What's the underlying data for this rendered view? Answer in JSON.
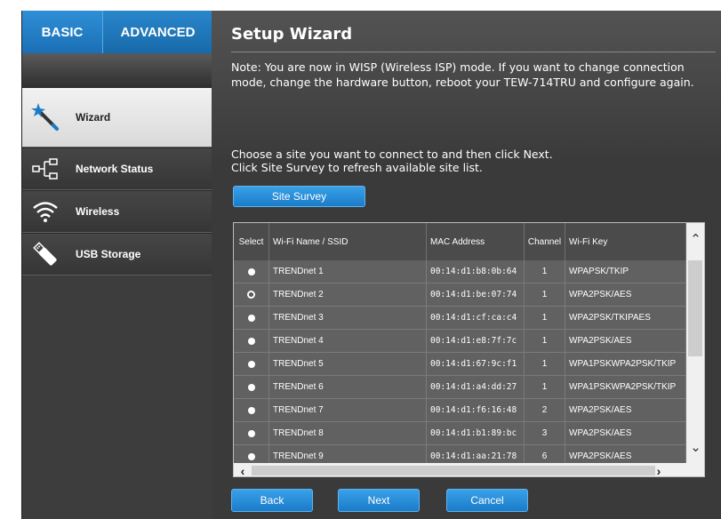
{
  "tabs": {
    "basic": "BASIC",
    "advanced": "ADVANCED"
  },
  "sidebar": {
    "items": [
      {
        "label": "Wizard",
        "icon": "wand-icon",
        "active": true
      },
      {
        "label": "Network Status",
        "icon": "network-tree-icon",
        "active": false
      },
      {
        "label": "Wireless",
        "icon": "wifi-icon",
        "active": false
      },
      {
        "label": "USB Storage",
        "icon": "usb-icon",
        "active": false
      }
    ]
  },
  "main": {
    "title": "Setup Wizard",
    "note": "Note: You are now in WISP (Wireless ISP) mode. If you want to change connection mode, change the hardware button, reboot your TEW-714TRU and configure again.",
    "instruction_1": "Choose a site you want to connect to and then click Next.",
    "instruction_2": "Click Site Survey to refresh available site list.",
    "site_survey_label": "Site Survey",
    "back_label": "Back",
    "next_label": "Next",
    "cancel_label": "Cancel"
  },
  "table": {
    "columns": [
      "Select",
      "Wi-Fi Name / SSID",
      "MAC Address",
      "Channel",
      "Wi-Fi Key"
    ],
    "rows": [
      {
        "ssid": "TRENDnet 1",
        "mac": "00:14:d1:b8:0b:64",
        "channel": "1",
        "key": "WPAPSK/TKIP",
        "selected": false
      },
      {
        "ssid": "TRENDnet 2",
        "mac": "00:14:d1:be:07:74",
        "channel": "1",
        "key": "WPA2PSK/AES",
        "selected": true
      },
      {
        "ssid": "TRENDnet 3",
        "mac": "00:14:d1:cf:ca:c4",
        "channel": "1",
        "key": "WPA2PSK/TKIPAES",
        "selected": false
      },
      {
        "ssid": "TRENDnet 4",
        "mac": "00:14:d1:e8:7f:7c",
        "channel": "1",
        "key": "WPA2PSK/AES",
        "selected": false
      },
      {
        "ssid": "TRENDnet 5",
        "mac": "00:14:d1:67:9c:f1",
        "channel": "1",
        "key": "WPA1PSKWPA2PSK/TKIP",
        "selected": false
      },
      {
        "ssid": "TRENDnet 6",
        "mac": "00:14:d1:a4:dd:27",
        "channel": "1",
        "key": "WPA1PSKWPA2PSK/TKIP",
        "selected": false
      },
      {
        "ssid": "TRENDnet 7",
        "mac": "00:14:d1:f6:16:48",
        "channel": "2",
        "key": "WPA2PSK/AES",
        "selected": false
      },
      {
        "ssid": "TRENDnet 8",
        "mac": "00:14:d1:b1:89:bc",
        "channel": "3",
        "key": "WPA2PSK/AES",
        "selected": false
      },
      {
        "ssid": "TRENDnet 9",
        "mac": "00:14:d1:aa:21:78",
        "channel": "6",
        "key": "WPA2PSK/AES",
        "selected": false
      }
    ]
  }
}
